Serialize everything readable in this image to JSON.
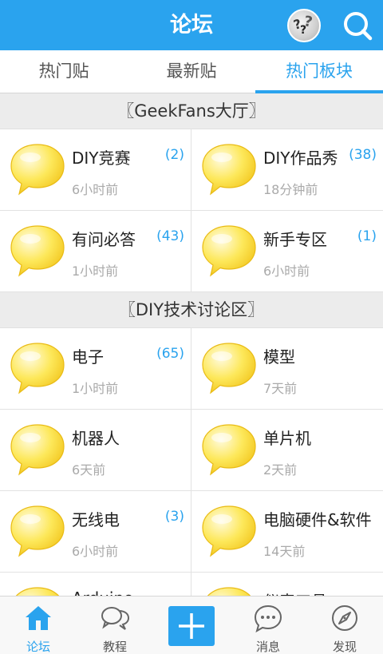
{
  "header": {
    "title": "论坛",
    "avatar_icon": "avatar-icon",
    "search_icon": "search-icon"
  },
  "tabs": [
    {
      "label": "热门贴",
      "active": false
    },
    {
      "label": "最新贴",
      "active": false
    },
    {
      "label": "热门板块",
      "active": true
    }
  ],
  "sections": [
    {
      "title": "〖GeekFans大厅〗",
      "boards": [
        {
          "name": "DIY竞赛",
          "count": "(2)",
          "time": "6小时前"
        },
        {
          "name": "DIY作品秀",
          "count": "(38)",
          "time": "18分钟前"
        },
        {
          "name": "有问必答",
          "count": "(43)",
          "time": "1小时前"
        },
        {
          "name": "新手专区",
          "count": "(1)",
          "time": "6小时前"
        }
      ]
    },
    {
      "title": "〖DIY技术讨论区〗",
      "boards": [
        {
          "name": "电子",
          "count": "(65)",
          "time": "1小时前"
        },
        {
          "name": "模型",
          "count": "",
          "time": "7天前"
        },
        {
          "name": "机器人",
          "count": "",
          "time": "6天前"
        },
        {
          "name": "单片机",
          "count": "",
          "time": "2天前"
        },
        {
          "name": "无线电",
          "count": "(3)",
          "time": "6小时前"
        },
        {
          "name": "电脑硬件&软件",
          "count": "",
          "time": "14天前"
        },
        {
          "name": "Arduino",
          "count": "",
          "time": ""
        },
        {
          "name": "仪表工具",
          "count": "",
          "time": ""
        }
      ]
    }
  ],
  "bottom_nav": [
    {
      "label": "论坛",
      "icon": "home-icon",
      "active": true
    },
    {
      "label": "教程",
      "icon": "chat-bubbles-icon",
      "active": false
    },
    {
      "label": "消息",
      "icon": "message-icon",
      "active": false
    },
    {
      "label": "发现",
      "icon": "compass-icon",
      "active": false
    }
  ],
  "post_button": {
    "icon": "plus-icon"
  },
  "colors": {
    "accent": "#2aa3ee",
    "bubble": "#fde85a"
  }
}
